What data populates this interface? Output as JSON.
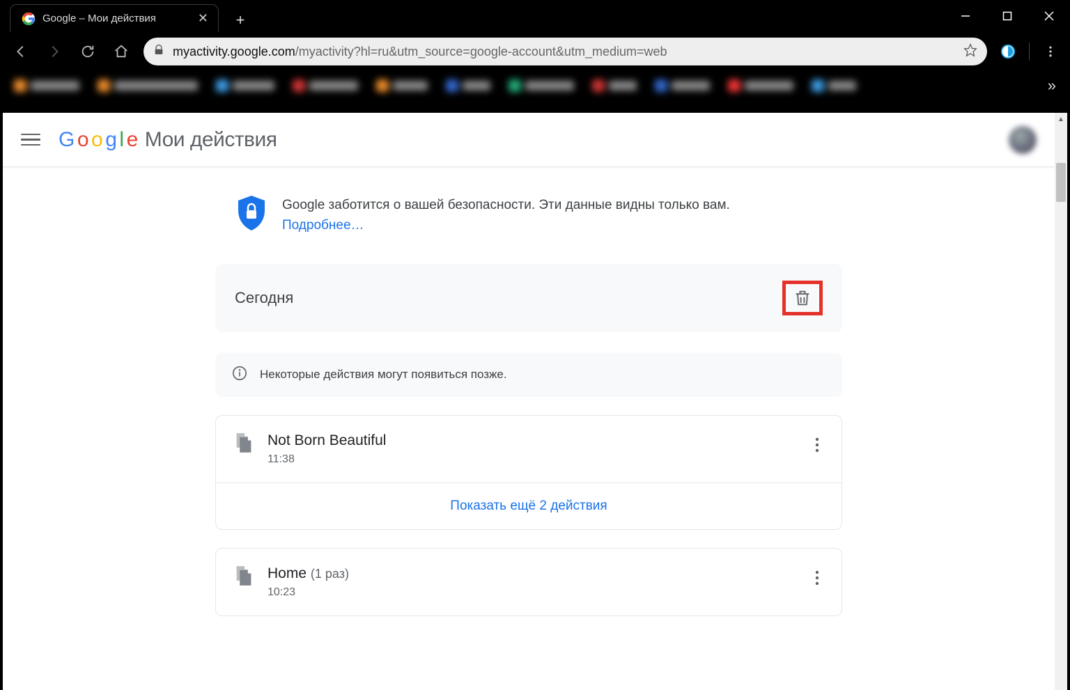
{
  "window": {
    "tab_title": "Google – Мои действия"
  },
  "omnibox": {
    "host": "myactivity.google.com",
    "path": "/myactivity?hl=ru&utm_source=google-account&utm_medium=web"
  },
  "google_header": {
    "product_name": "Мои действия"
  },
  "safety_banner": {
    "text": "Google заботится о вашей безопасности. Эти данные видны только вам.",
    "learn_more": "Подробнее…"
  },
  "day_header": {
    "label": "Сегодня"
  },
  "notice": {
    "text": "Некоторые действия могут появиться позже."
  },
  "activities": [
    {
      "title": "Not Born Beautiful",
      "count_suffix": "",
      "time": "11:38"
    },
    {
      "title": "Home",
      "count_suffix": "(1 раз)",
      "time": "10:23"
    }
  ],
  "show_more": "Показать ещё 2 действия"
}
